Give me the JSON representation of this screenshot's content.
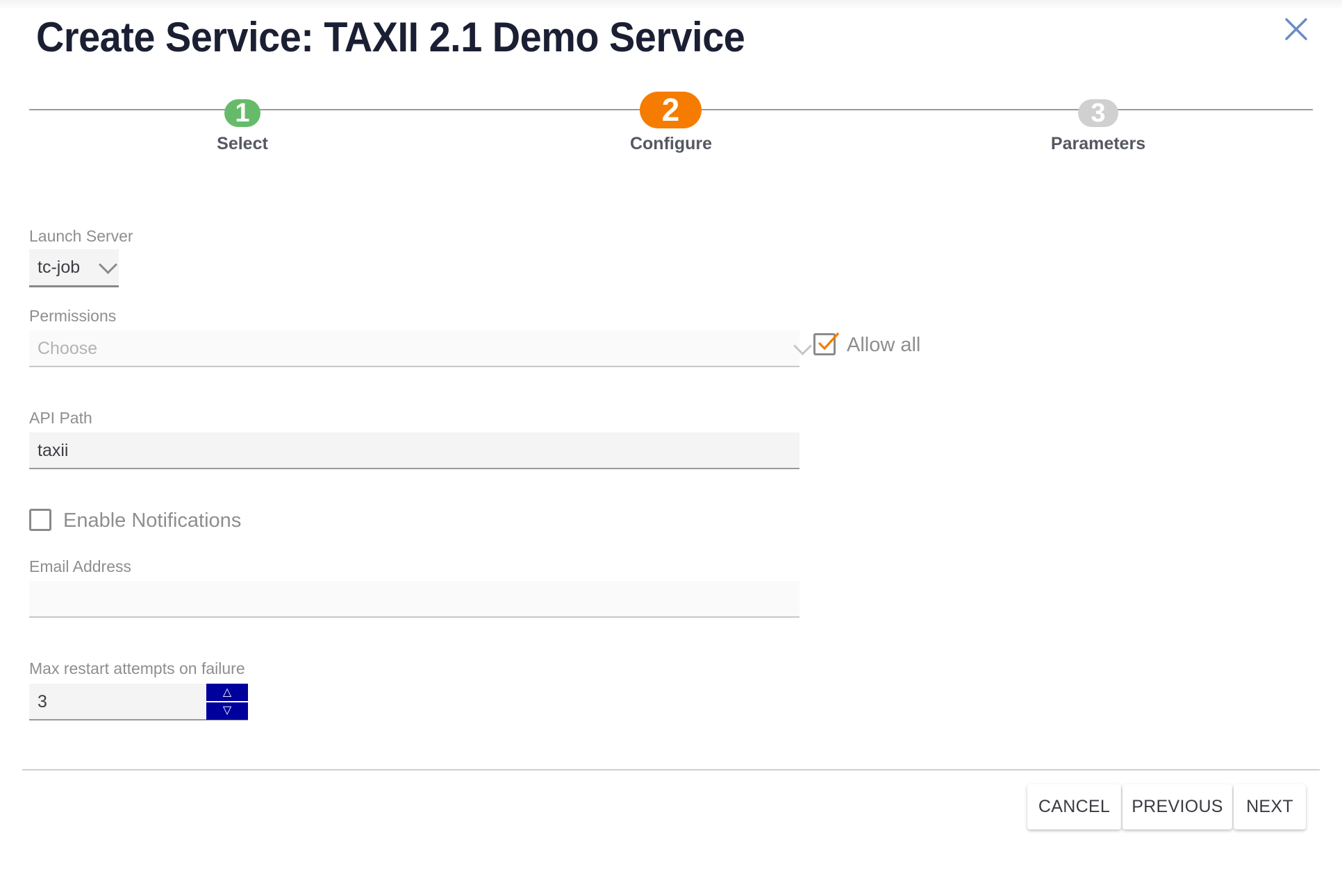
{
  "dialog": {
    "title": "Create Service: TAXII 2.1 Demo Service",
    "close_icon": "close-icon"
  },
  "stepper": {
    "steps": [
      {
        "number": "1",
        "label": "Select",
        "state": "complete",
        "color": "#66bb6a"
      },
      {
        "number": "2",
        "label": "Configure",
        "state": "active",
        "color": "#f57c00"
      },
      {
        "number": "3",
        "label": "Parameters",
        "state": "pending",
        "color": "#d0d0d0"
      }
    ]
  },
  "form": {
    "launch_server": {
      "label": "Launch Server",
      "value": "tc-job"
    },
    "permissions": {
      "label": "Permissions",
      "placeholder": "Choose",
      "allow_all_label": "Allow all",
      "allow_all_checked": true
    },
    "api_path": {
      "label": "API Path",
      "value": "taxii"
    },
    "enable_notifications": {
      "label": "Enable Notifications",
      "checked": false
    },
    "email": {
      "label": "Email Address",
      "value": ""
    },
    "max_restart": {
      "label": "Max restart attempts on failure",
      "value": "3",
      "up_icon": "△",
      "down_icon": "▽"
    }
  },
  "footer": {
    "cancel_label": "CANCEL",
    "previous_label": "PREVIOUS",
    "next_label": "NEXT"
  },
  "colors": {
    "accent": "#f57c00",
    "spinner": "#00009c",
    "close": "#6b8cc4"
  }
}
